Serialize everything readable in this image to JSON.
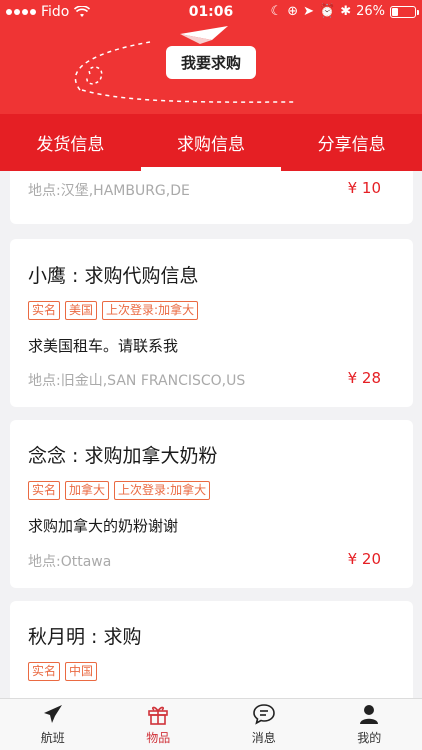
{
  "status_bar": {
    "carrier": "Fido",
    "time": "01:06",
    "battery": "26%",
    "battery_level": 0.26
  },
  "hero": {
    "request_button": "我要求购"
  },
  "tabs": [
    {
      "label": "发货信息",
      "active": false
    },
    {
      "label": "求购信息",
      "active": true
    },
    {
      "label": "分享信息",
      "active": false
    }
  ],
  "cards": [
    {
      "location": "地点:汉堡,HAMBURG,DE",
      "price": "¥ 10"
    },
    {
      "title": "小鹰 : 求购代购信息",
      "badges": [
        "实名",
        "美国",
        "上次登录:加拿大"
      ],
      "desc": "求美国租车。请联系我",
      "location": "地点:旧金山,SAN FRANCISCO,US",
      "price": "¥ 28"
    },
    {
      "title": "念念 : 求购加拿大奶粉",
      "badges": [
        "实名",
        "加拿大",
        "上次登录:加拿大"
      ],
      "desc": "求购加拿大的奶粉谢谢",
      "location": "地点:Ottawa",
      "price": "¥ 20"
    },
    {
      "title": "秋月明 : 求购",
      "badges": [
        "实名",
        "中国"
      ]
    }
  ],
  "tabbar": [
    {
      "label": "航班",
      "icon": "airplane-icon",
      "active": false
    },
    {
      "label": "物品",
      "icon": "gift-icon",
      "active": true
    },
    {
      "label": "消息",
      "icon": "chat-icon",
      "active": false
    },
    {
      "label": "我的",
      "icon": "person-icon",
      "active": false
    }
  ],
  "colors": {
    "brand_red": "#ef3434",
    "tab_red": "#e51f24",
    "badge_orange": "#ea6a42"
  }
}
